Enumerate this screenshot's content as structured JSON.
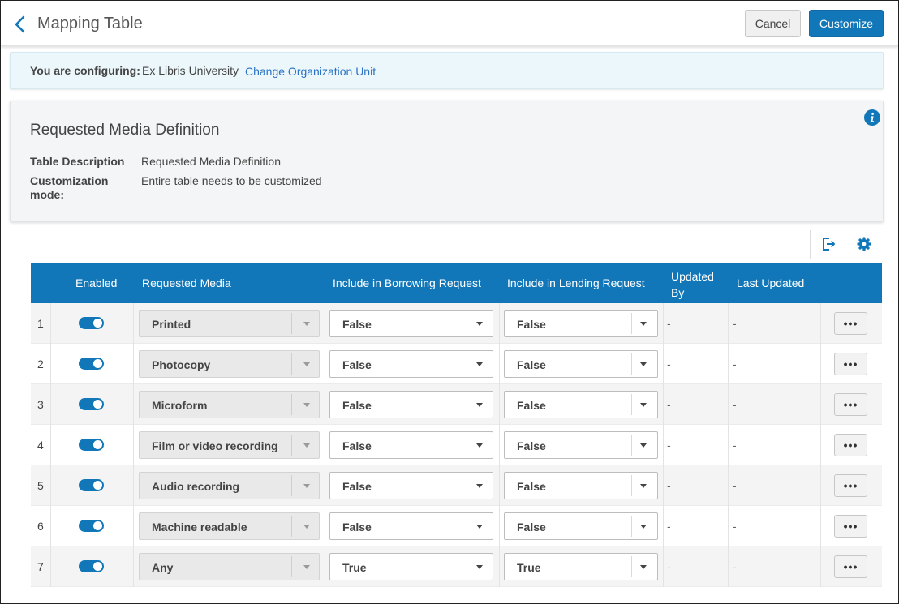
{
  "header": {
    "title": "Mapping Table",
    "cancel_label": "Cancel",
    "customize_label": "Customize"
  },
  "config": {
    "label": "You are configuring:",
    "value": "Ex Libris University",
    "link": "Change Organization Unit"
  },
  "card": {
    "title": "Requested Media Definition",
    "description_label": "Table Description",
    "description_value": "Requested Media Definition",
    "mode_label": "Customization mode:",
    "mode_value": "Entire table needs to be customized"
  },
  "table": {
    "columns": {
      "enabled": "Enabled",
      "requested_media": "Requested Media",
      "borrowing": "Include in Borrowing Request",
      "lending": "Include in Lending Request",
      "updated_by": "Updated By",
      "last_updated": "Last Updated"
    },
    "rows": [
      {
        "num": "1",
        "enabled": true,
        "media": "Printed",
        "borrowing": "False",
        "lending": "False",
        "updated_by": "-",
        "last_updated": "-",
        "more": "•••"
      },
      {
        "num": "2",
        "enabled": true,
        "media": "Photocopy",
        "borrowing": "False",
        "lending": "False",
        "updated_by": "-",
        "last_updated": "-",
        "more": "•••"
      },
      {
        "num": "3",
        "enabled": true,
        "media": "Microform",
        "borrowing": "False",
        "lending": "False",
        "updated_by": "-",
        "last_updated": "-",
        "more": "•••"
      },
      {
        "num": "4",
        "enabled": true,
        "media": "Film or video recording",
        "borrowing": "False",
        "lending": "False",
        "updated_by": "-",
        "last_updated": "-",
        "more": "•••"
      },
      {
        "num": "5",
        "enabled": true,
        "media": "Audio recording",
        "borrowing": "False",
        "lending": "False",
        "updated_by": "-",
        "last_updated": "-",
        "more": "•••"
      },
      {
        "num": "6",
        "enabled": true,
        "media": "Machine readable",
        "borrowing": "False",
        "lending": "False",
        "updated_by": "-",
        "last_updated": "-",
        "more": "•••"
      },
      {
        "num": "7",
        "enabled": true,
        "media": "Any",
        "borrowing": "True",
        "lending": "True",
        "updated_by": "-",
        "last_updated": "-",
        "more": "•••"
      }
    ]
  },
  "colors": {
    "primary": "#1177b9",
    "config_bg": "#ecf7fb",
    "card_bg": "#f3f5f6",
    "link": "#2a72c4"
  },
  "icons": {
    "back": "chevron-left-icon",
    "info": "info-icon",
    "export": "export-icon",
    "settings": "gear-icon"
  }
}
